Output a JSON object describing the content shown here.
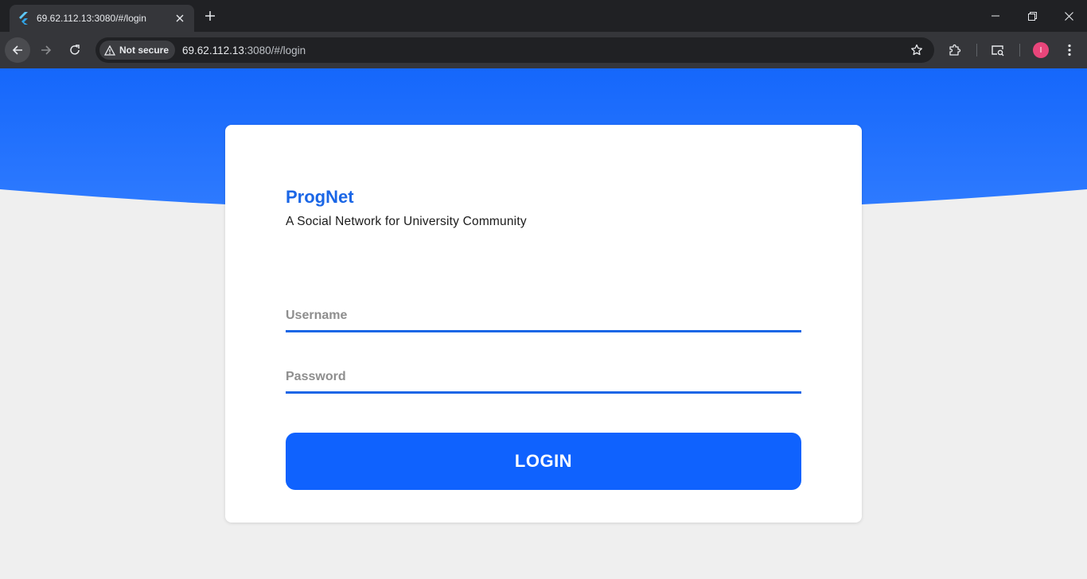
{
  "browser": {
    "tab_title": "69.62.112.13:3080/#/login",
    "security_label": "Not secure",
    "url_host": "69.62.112.13",
    "url_rest": ":3080/#/login",
    "profile_initial": "I"
  },
  "login": {
    "brand": "ProgNet",
    "tagline": "A Social Network for University Community",
    "username_placeholder": "Username",
    "password_placeholder": "Password",
    "login_label": "LOGIN"
  },
  "colors": {
    "accent": "#1a66e6",
    "button": "#0f62fe",
    "banner": "#1a6bff",
    "background": "#efefef",
    "avatar": "#e8457a"
  },
  "icons": [
    "flutter-favicon-icon",
    "close-icon",
    "plus-icon",
    "minimize-icon",
    "restore-icon",
    "back-arrow-icon",
    "forward-arrow-icon",
    "reload-icon",
    "warning-triangle-icon",
    "star-icon",
    "extension-puzzle-icon",
    "cast-search-icon",
    "kebab-menu-icon"
  ]
}
